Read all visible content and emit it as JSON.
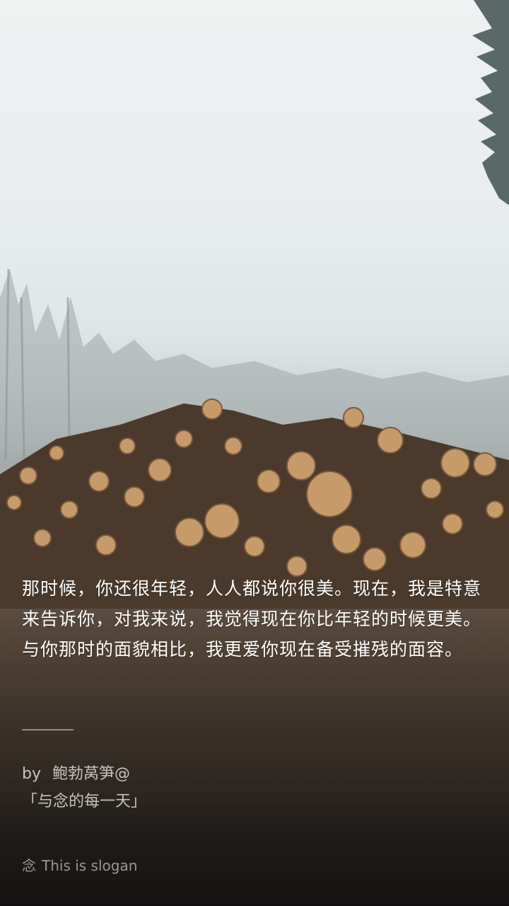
{
  "quote": {
    "text": "那时候，你还很年轻，人人都说你很美。现在，我是特意来告诉你，对我来说，我觉得现在你比年轻的时候更美。与你那时的面貌相比，我更爱你现在备受摧残的面容。"
  },
  "author": {
    "prefix": "by",
    "name": "鲍勃莴笋@"
  },
  "source": {
    "label": "「与念的每一天」"
  },
  "footer": {
    "icon_glyph": "念",
    "slogan": "This is slogan"
  }
}
